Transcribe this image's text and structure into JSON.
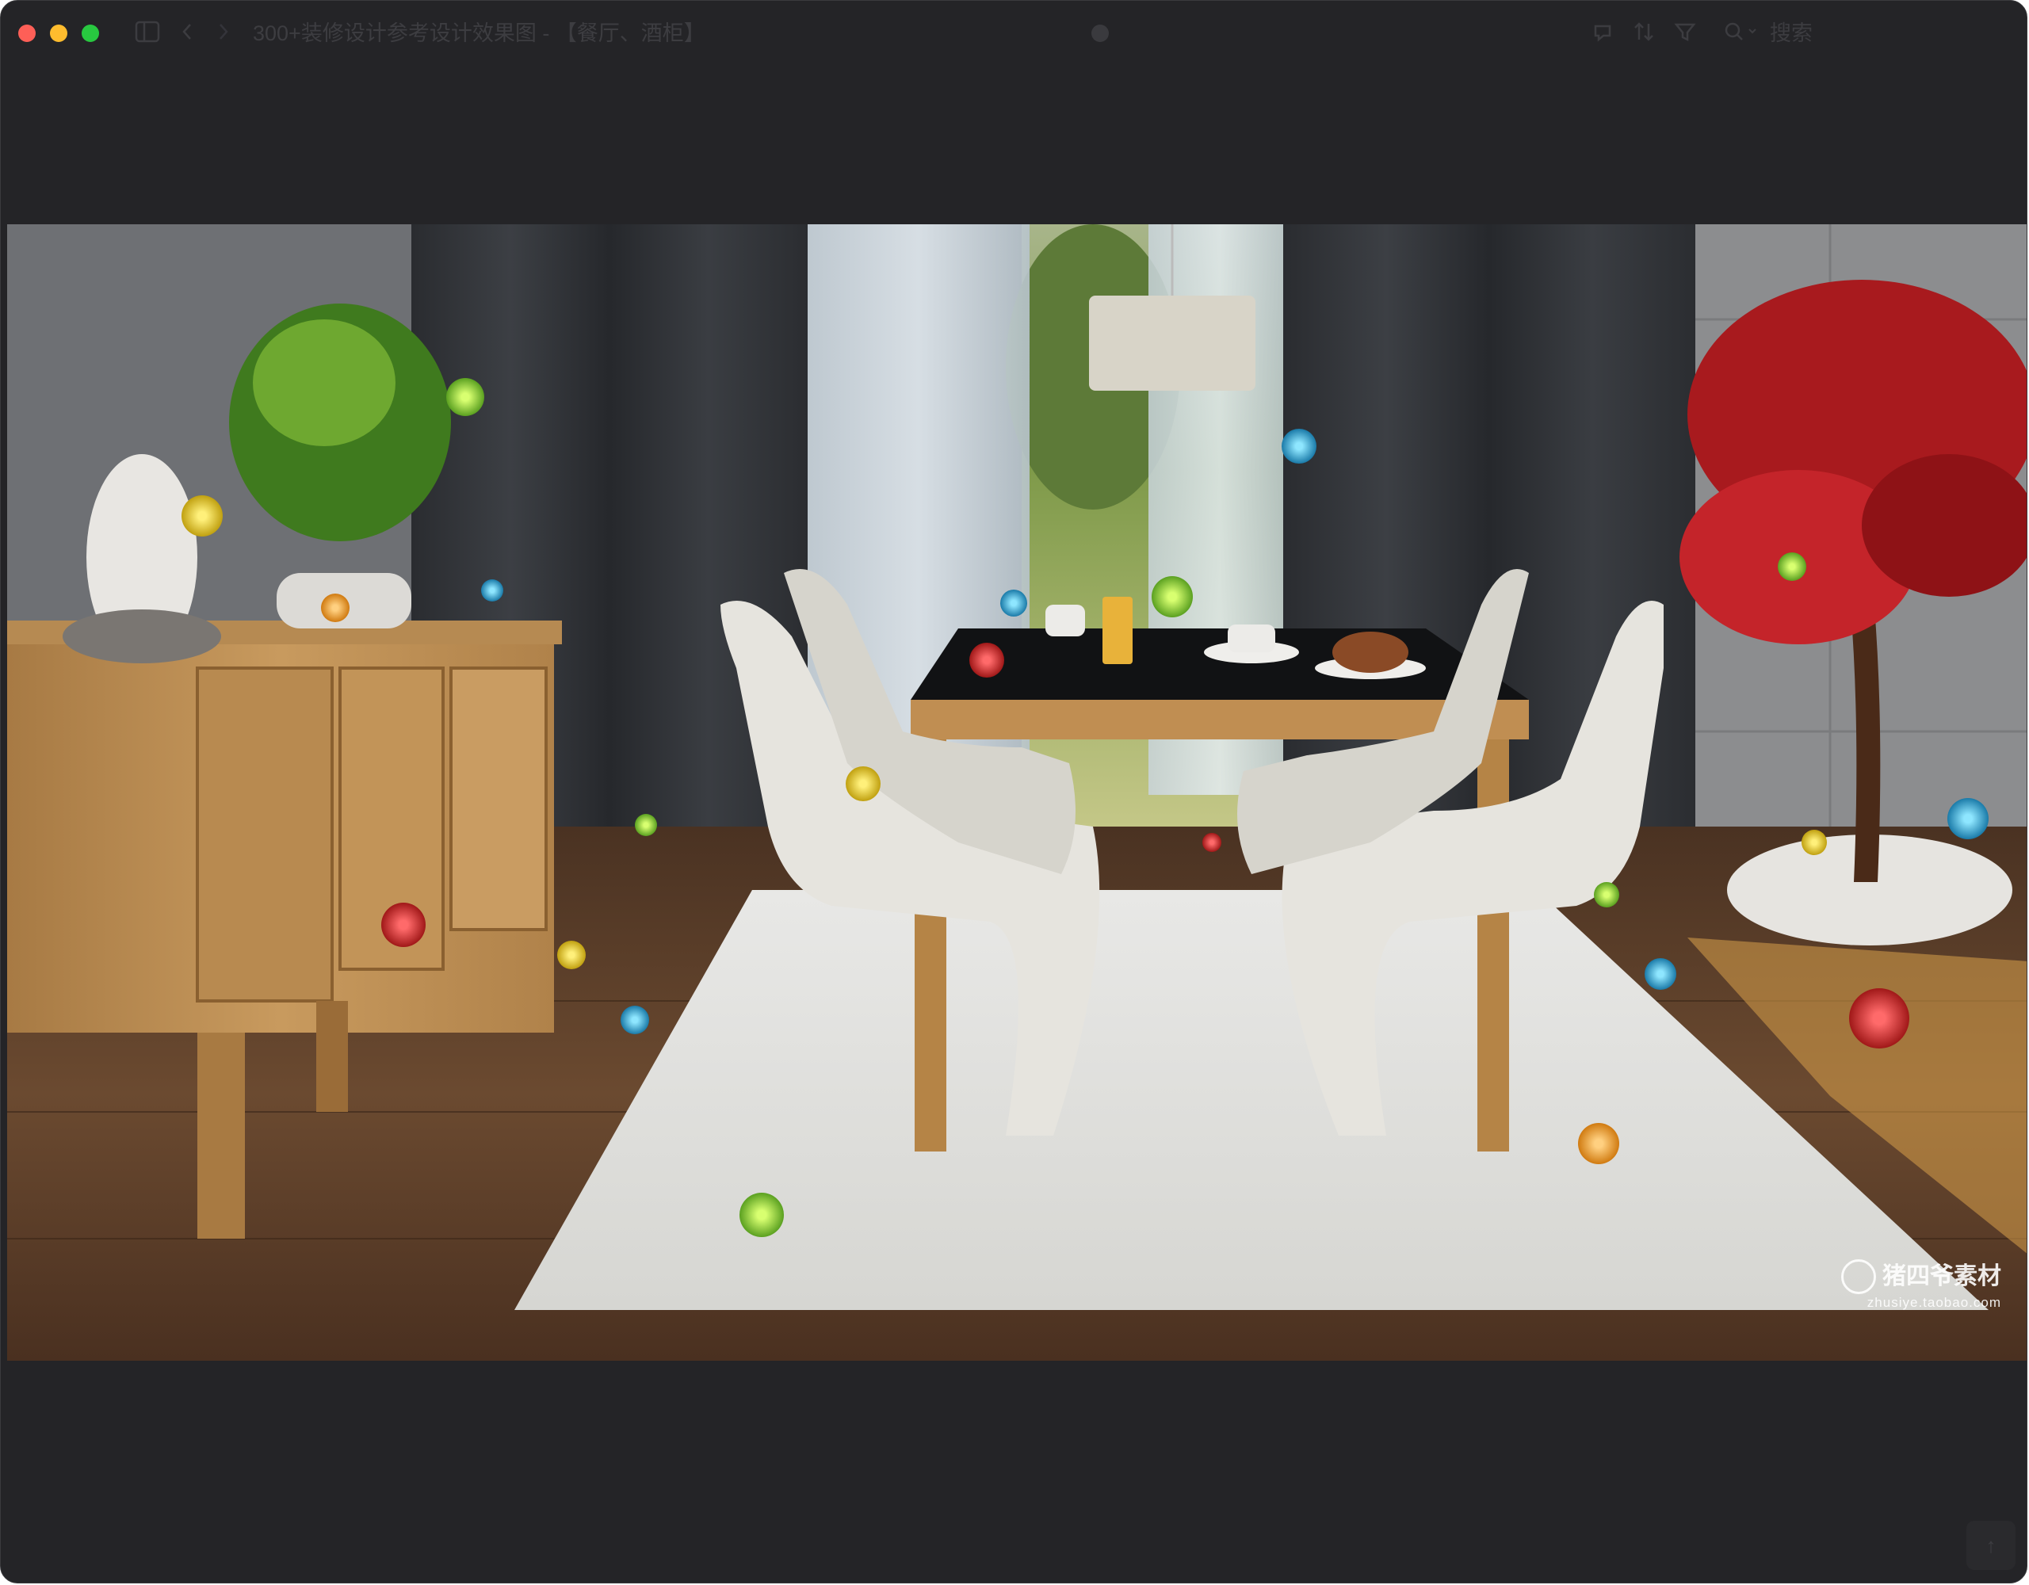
{
  "window": {
    "title": "300+装修设计参考设计效果图 - 【餐厅、酒柜】",
    "search_placeholder": "搜索"
  },
  "icons": {
    "sidebar": "sidebar-toggle-icon",
    "back": "chevron-left-icon",
    "forward": "chevron-right-icon",
    "share": "share-icon",
    "sort": "sort-icon",
    "filter": "filter-icon",
    "search": "search-icon",
    "scroll_top": "arrow-up-icon"
  },
  "image": {
    "description_alt": "室内餐厅效果图",
    "watermark_main": "猪四爷素材",
    "watermark_sub": "zhusiye.taobao.com"
  },
  "colors": {
    "window_bg": "#242427",
    "close": "#fe5f57",
    "minimize": "#febc2e",
    "maximize": "#28c840"
  }
}
